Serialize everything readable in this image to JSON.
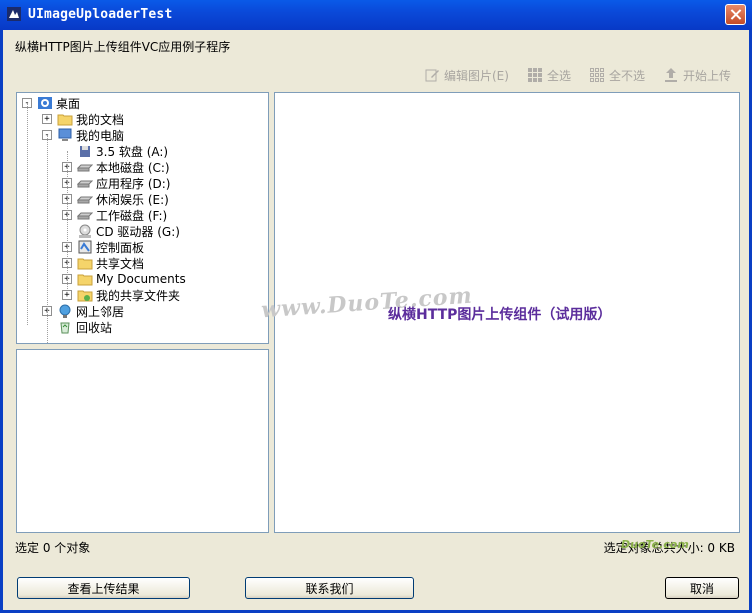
{
  "window": {
    "title": "UImageUploaderTest"
  },
  "subtitle": "纵横HTTP图片上传组件VC应用例子程序",
  "toolbar": {
    "edit_label": "编辑图片(E)",
    "select_all_label": "全选",
    "select_none_label": "全不选",
    "upload_label": "开始上传"
  },
  "tree": {
    "items": [
      {
        "label": "桌面",
        "icon": "desktop-icon"
      },
      {
        "label": "我的文档",
        "icon": "folder-icon"
      },
      {
        "label": "我的电脑",
        "icon": "computer-icon"
      },
      {
        "label": "3.5 软盘 (A:)",
        "icon": "floppy-icon"
      },
      {
        "label": "本地磁盘 (C:)",
        "icon": "drive-icon"
      },
      {
        "label": "应用程序 (D:)",
        "icon": "drive-icon"
      },
      {
        "label": "休闲娱乐 (E:)",
        "icon": "drive-icon"
      },
      {
        "label": "工作磁盘 (F:)",
        "icon": "drive-icon"
      },
      {
        "label": "CD 驱动器 (G:)",
        "icon": "cd-icon"
      },
      {
        "label": "控制面板",
        "icon": "control-panel-icon"
      },
      {
        "label": "共享文档",
        "icon": "folder-icon"
      },
      {
        "label": "My Documents",
        "icon": "folder-icon"
      },
      {
        "label": "我的共享文件夹",
        "icon": "shared-folder-icon"
      },
      {
        "label": "网上邻居",
        "icon": "network-icon"
      },
      {
        "label": "回收站",
        "icon": "recycle-bin-icon"
      }
    ]
  },
  "gallery": {
    "watermark": "www.DuoTe.com",
    "center_label": "纵横HTTP图片上传组件（试用版）"
  },
  "status": {
    "selected_count": "选定 0 个对象",
    "selected_size": "选定对象总共大小: 0 KB"
  },
  "buttons": {
    "view_results": "查看上传结果",
    "contact_us": "联系我们",
    "cancel": "取消"
  },
  "logo_text": "DuoTe.com",
  "colors": {
    "titlebar": "#0a49d9",
    "accent_text": "#5b2d9c",
    "window_bg": "#ece9d8"
  }
}
